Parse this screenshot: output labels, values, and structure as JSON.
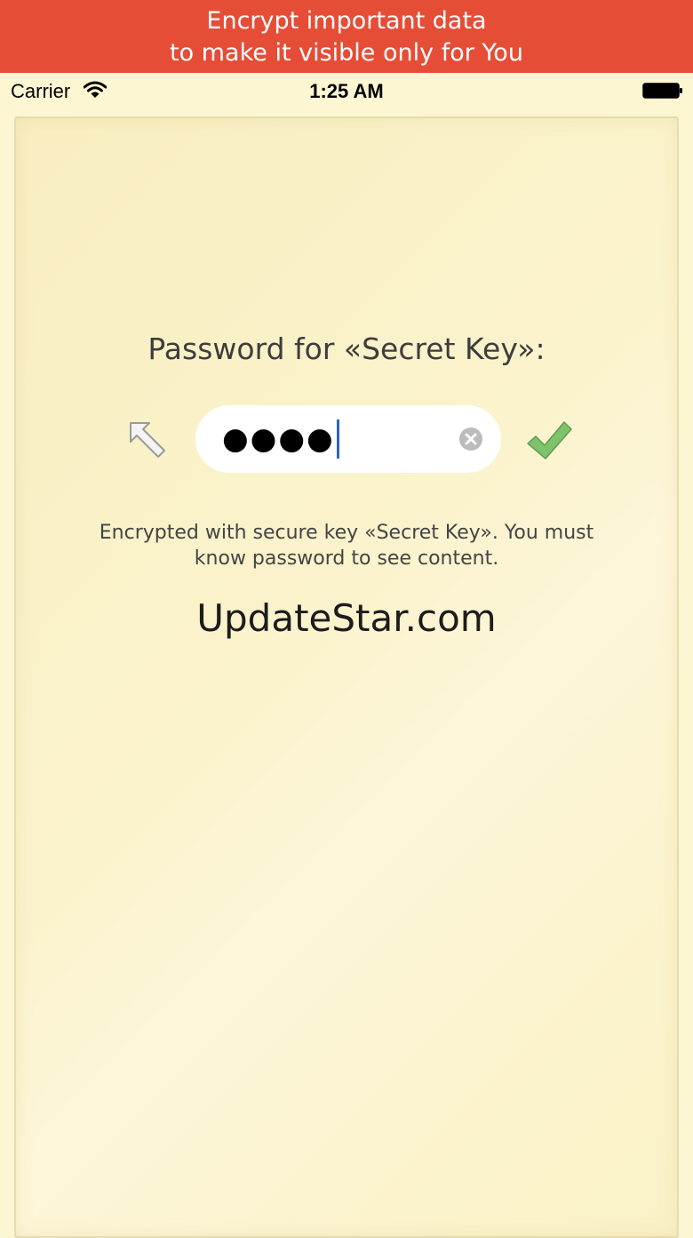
{
  "banner": {
    "line1": "Encrypt important data",
    "line2": "to make it visible only for You"
  },
  "status_bar": {
    "carrier": "Carrier",
    "time": "1:25 AM",
    "icons": [
      "wifi-icon",
      "battery-icon"
    ]
  },
  "unlock": {
    "prompt": "Password for «Secret Key»:",
    "password_value": "●●●●",
    "info_text": "Encrypted with secure key «Secret Key». You must know password to see content.",
    "icons": {
      "back": "arrow-up-left-icon",
      "clear": "clear-circle-icon",
      "confirm": "checkmark-icon"
    }
  },
  "watermark": "UpdateStar.com",
  "colors": {
    "banner": "#e64d37",
    "background": "#fdf6d3",
    "checkmark": "#7fc26b",
    "caret": "#2f62c8"
  }
}
